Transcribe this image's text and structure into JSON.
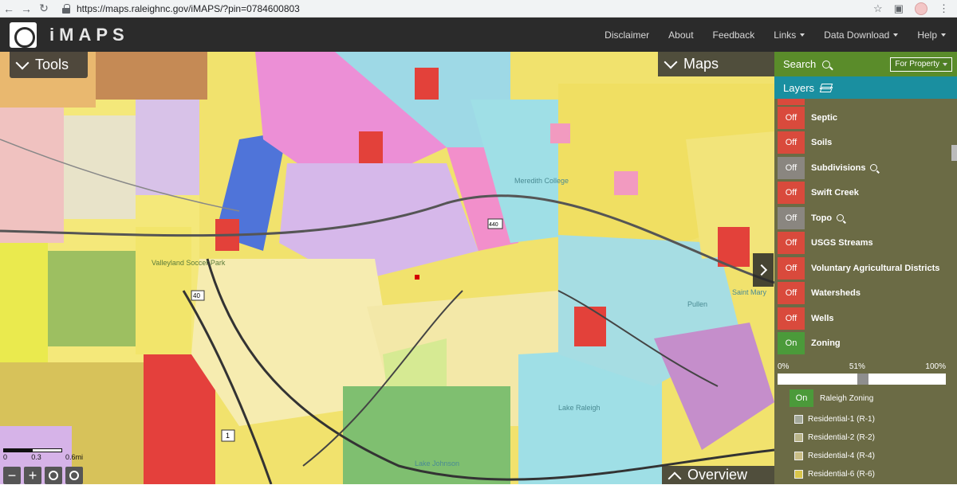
{
  "browser": {
    "url": "https://maps.raleighnc.gov/iMAPS/?pin=0784600803"
  },
  "header": {
    "app_title": "iMAPS",
    "menu": [
      {
        "label": "Disclaimer",
        "dropdown": false
      },
      {
        "label": "About",
        "dropdown": false
      },
      {
        "label": "Feedback",
        "dropdown": false
      },
      {
        "label": "Links",
        "dropdown": true
      },
      {
        "label": "Data Download",
        "dropdown": true
      },
      {
        "label": "Help",
        "dropdown": true
      }
    ]
  },
  "map": {
    "tools_label": "Tools",
    "maps_label": "Maps",
    "overview_label": "Overview",
    "scale": {
      "labels": [
        "0",
        "0.3",
        "0.6mi"
      ]
    },
    "labels": [
      "Meredith College",
      "Lake Raleigh",
      "Lake Johnson",
      "Pullen",
      "Saint Mary",
      "Valleyland Soccer Park"
    ],
    "road_shields": [
      "40",
      "1",
      "440"
    ]
  },
  "side": {
    "search_label": "Search",
    "search_mode": "For Property",
    "layers_label": "Layers",
    "layers": [
      {
        "label": "Septic",
        "state": "Off",
        "zoom": false
      },
      {
        "label": "Soils",
        "state": "Off",
        "zoom": false
      },
      {
        "label": "Subdivisions",
        "state": "Off",
        "zoom": true
      },
      {
        "label": "Swift Creek",
        "state": "Off",
        "zoom": false
      },
      {
        "label": "Topo",
        "state": "Off",
        "zoom": true
      },
      {
        "label": "USGS Streams",
        "state": "Off",
        "zoom": false
      },
      {
        "label": "Voluntary Agricultural Districts",
        "state": "Off",
        "zoom": false
      },
      {
        "label": "Watersheds",
        "state": "Off",
        "zoom": false
      },
      {
        "label": "Wells",
        "state": "Off",
        "zoom": false
      },
      {
        "label": "Zoning",
        "state": "On",
        "zoom": false
      }
    ],
    "opacity": {
      "min": "0%",
      "value_label": "51%",
      "max": "100%",
      "value": 0.51
    },
    "sublayer": {
      "state": "On",
      "label": "Raleigh Zoning"
    },
    "legend": [
      {
        "label": "Residential-1 (R-1)",
        "color": "#a3a89a"
      },
      {
        "label": "Residential-2 (R-2)",
        "color": "#b9b489"
      },
      {
        "label": "Residential-4 (R-4)",
        "color": "#c9bd85"
      },
      {
        "label": "Residential-6 (R-6)",
        "color": "#d9c64a"
      }
    ]
  },
  "colors": {
    "header_bg": "#2b2b2b",
    "search_bg": "#5a8c2a",
    "layers_bg": "#1a8fa0",
    "off": "#d94a3c",
    "on": "#4b9a3a"
  }
}
